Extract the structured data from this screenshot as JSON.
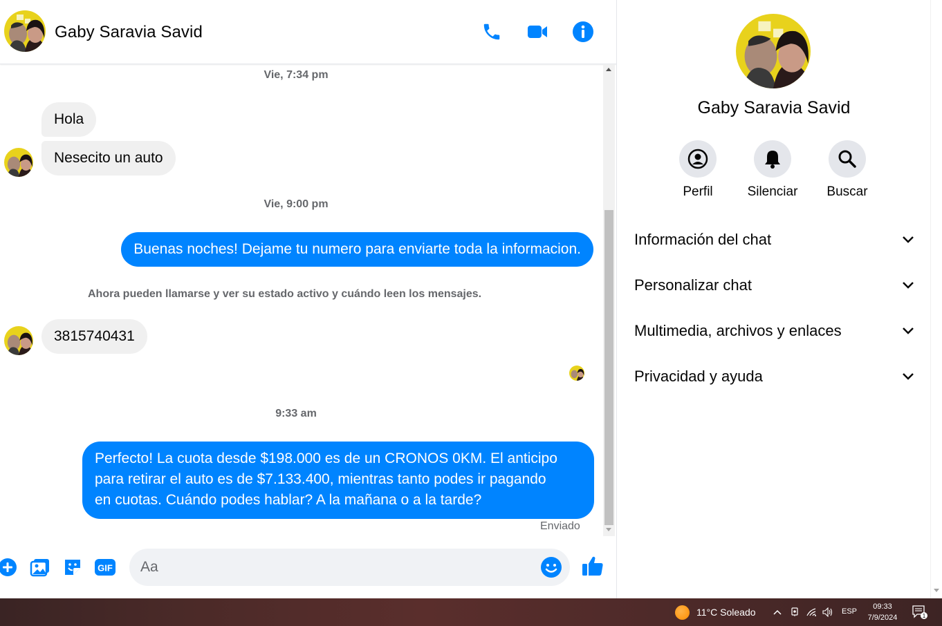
{
  "contact": {
    "name": "Gaby Saravia Savid"
  },
  "header_actions": [
    "phone-icon",
    "video-camera-icon",
    "info-icon"
  ],
  "messages": {
    "timestamp_1": "Vie, 7:34 pm",
    "in_1": "Hola",
    "in_2": "Nesecito un auto",
    "timestamp_2": "Vie, 9:00 pm",
    "out_1": "Buenas noches! Dejame tu numero para enviarte toda la informacion.",
    "system_note": "Ahora pueden llamarse y ver su estado activo y cuándo leen los mensajes.",
    "in_3": "3815740431",
    "timestamp_3": "9:33 am",
    "out_2_line1": "Perfecto! La cuota desde $198.000 es de un CRONOS 0KM. El anticipo",
    "out_2_line2": "para retirar el auto es de $7.133.400, mientras tanto podes ir pagando",
    "out_2_line3": "en cuotas. Cuándo podes hablar? A la mañana o a la tarde?",
    "status": "Enviado"
  },
  "composer": {
    "placeholder": "Aa",
    "icons": [
      "plus-icon",
      "photo-icon",
      "sticker-icon",
      "gif-icon",
      "emoji-icon",
      "thumbs-up-icon"
    ],
    "gif_label": "GIF"
  },
  "details": {
    "name": "Gaby Saravia Savid",
    "actions": [
      {
        "label": "Perfil",
        "icon": "profile-icon"
      },
      {
        "label": "Silenciar",
        "icon": "bell-icon"
      },
      {
        "label": "Buscar",
        "icon": "search-icon"
      }
    ],
    "sections": [
      "Información del chat",
      "Personalizar chat",
      "Multimedia, archivos y enlaces",
      "Privacidad y ayuda"
    ]
  },
  "taskbar": {
    "weather": "11°C  Soleado",
    "language": "ESP",
    "time": "09:33",
    "date": "7/9/2024",
    "notification_count": "1"
  },
  "colors": {
    "brand_blue": "#0084ff",
    "incoming_bubble": "#f0f0f0",
    "muted_text": "#65676b"
  }
}
